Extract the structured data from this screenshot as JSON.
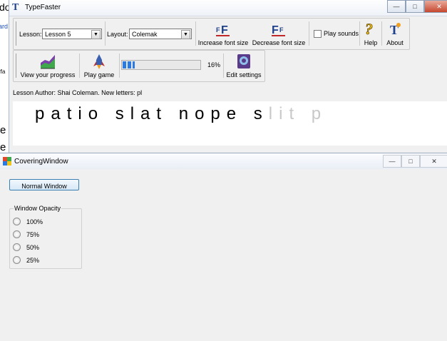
{
  "background_window": {
    "fragments": [
      "do",
      "ard",
      "rfa",
      "e",
      "e"
    ]
  },
  "typefaster": {
    "title": "TypeFaster",
    "toolbar1": {
      "lesson_label": "Lesson:",
      "lesson_value": "Lesson 5",
      "layout_label": "Layout:",
      "layout_value": "Colemak",
      "increase_font_label": "Increase font size",
      "decrease_font_label": "Decrease font size",
      "play_sounds_label": "Play sounds",
      "help_label": "Help",
      "about_label": "About"
    },
    "toolbar2": {
      "view_progress_label": "View your progress",
      "play_game_label": "Play game",
      "progress_percent_text": "16%",
      "progress_fraction": 0.16,
      "edit_settings_label": "Edit settings"
    },
    "author_line": "Lesson Author: Shai Coleman. New letters: pl",
    "lesson_typed": "patio slat nope s",
    "lesson_untyped": "lit p"
  },
  "covering_window": {
    "title": "CoveringWindow",
    "normal_window_button": "Normal Window",
    "opacity_group_label": "Window Opacity",
    "opacity_options": [
      "100%",
      "75%",
      "50%",
      "25%"
    ]
  },
  "colors": {
    "accent_blue": "#2a7ae2",
    "titlebar_icon": "#1e3f8a",
    "close_button": "#c6472e"
  }
}
